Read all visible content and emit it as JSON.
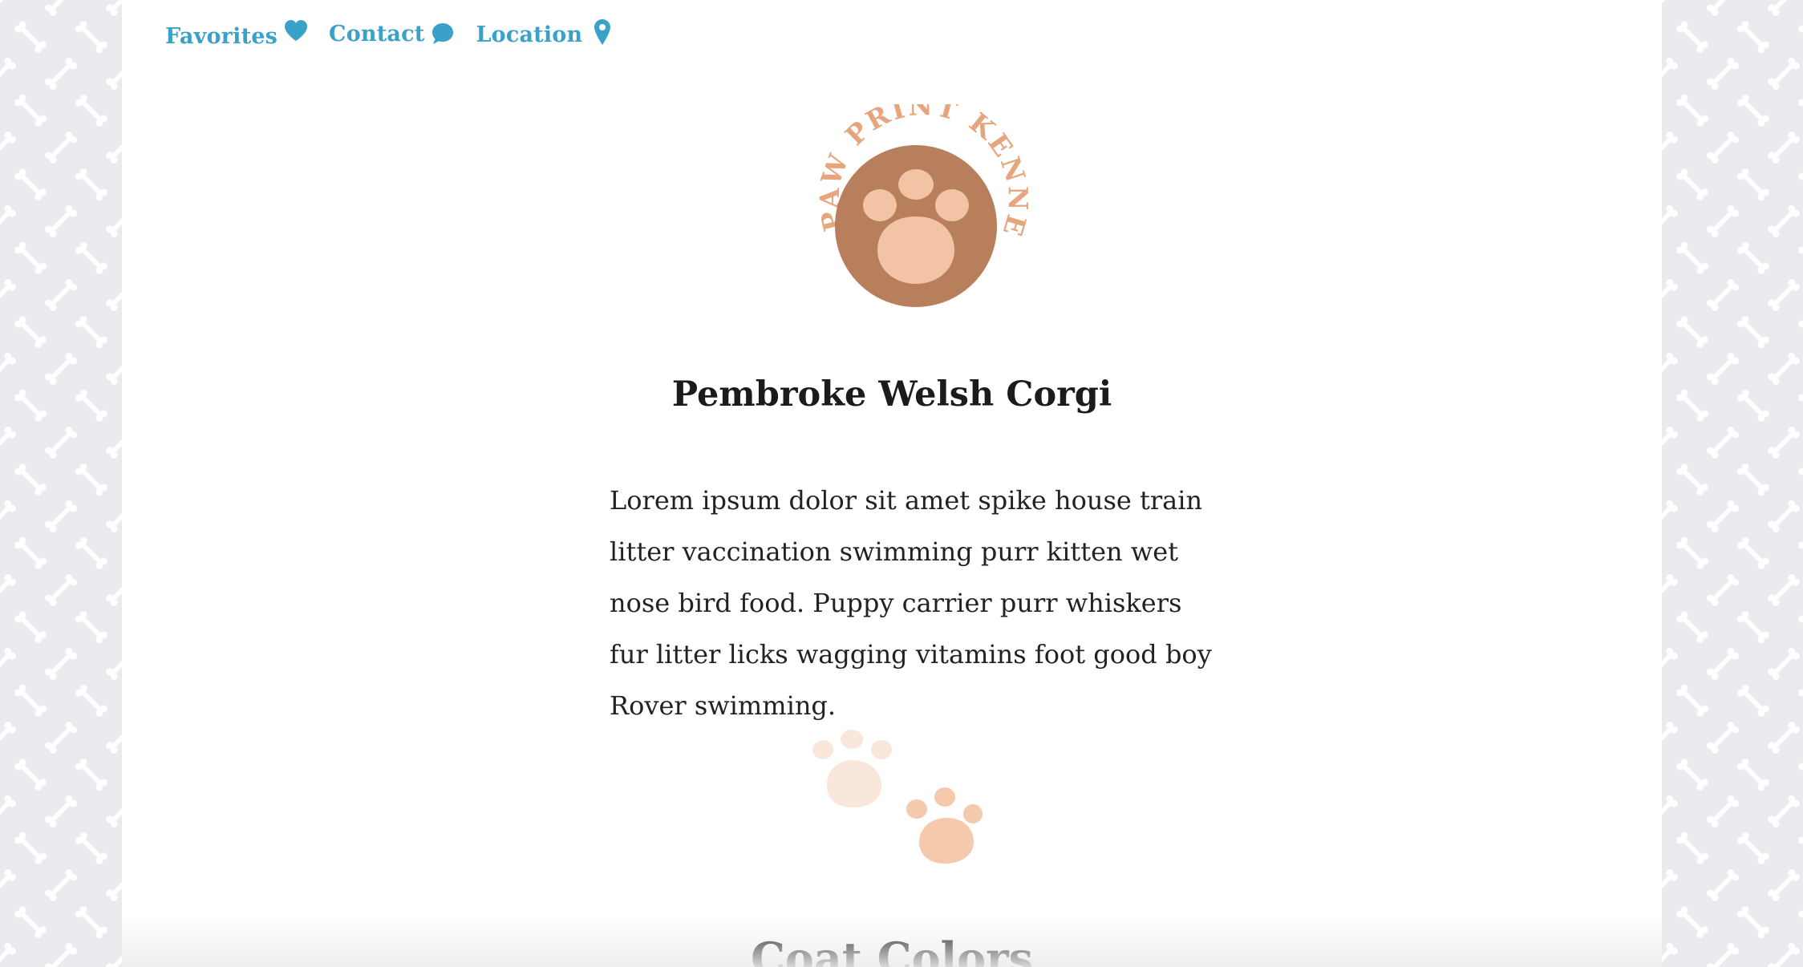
{
  "nav": {
    "items": [
      {
        "label": "Favorites",
        "icon": "heart-icon"
      },
      {
        "label": "Contact",
        "icon": "speech-bubble-icon"
      },
      {
        "label": "Location",
        "icon": "map-pin-icon"
      }
    ]
  },
  "logo": {
    "text": "PAW PRINT KENNELS",
    "icon": "paw-icon"
  },
  "breed": {
    "title": "Pembroke Welsh Corgi",
    "description": "Lorem ipsum dolor sit amet spike house train litter vaccination swimming purr kitten wet nose bird food. Puppy carrier purr whiskers fur litter licks wagging vitamins foot good boy Rover swimming."
  },
  "sections": {
    "coat_title": "Coat Colors"
  },
  "colors": {
    "accent_link": "#3aa1c9",
    "logo_brown": "#b87f5d",
    "logo_peach": "#f2c4a5",
    "logo_text": "#e6a57c",
    "paw_light": "#fae7dc",
    "paw_medium": "#f5c9ab",
    "background_pattern": "#e9ebee"
  }
}
